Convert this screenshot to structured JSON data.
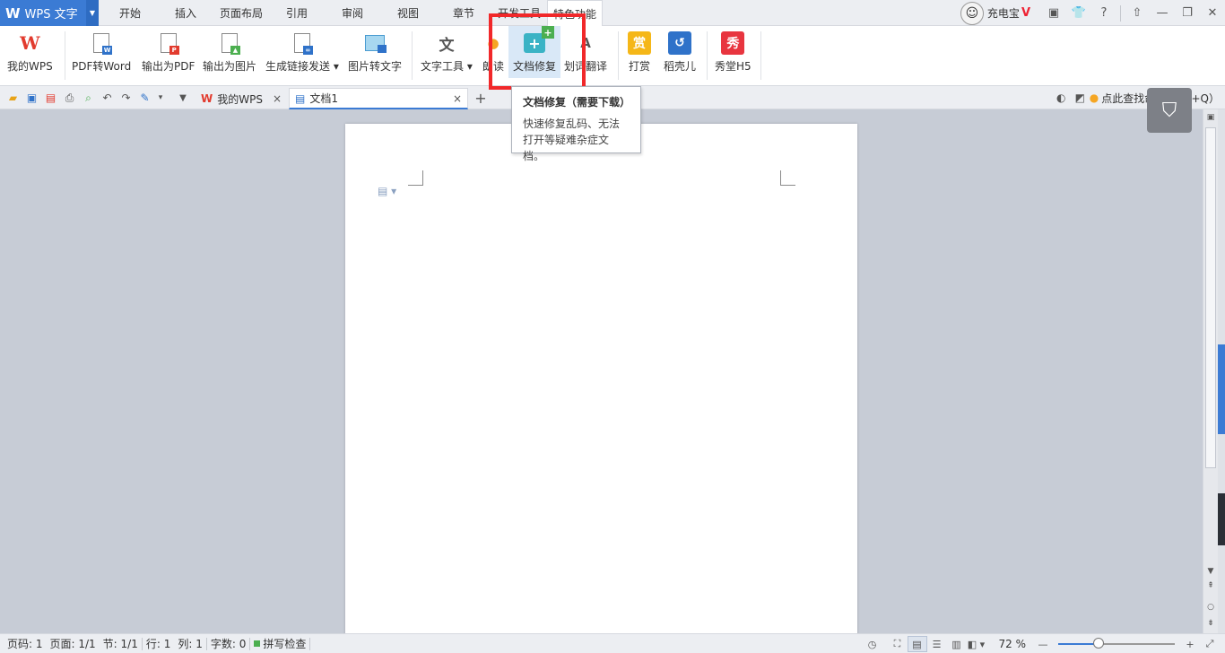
{
  "app": {
    "logo": "W",
    "name": "WPS 文字",
    "dropdown": "▼"
  },
  "menu": {
    "tabs": [
      "开始",
      "插入",
      "页面布局",
      "引用",
      "审阅",
      "视图",
      "章节",
      "开发工具",
      "特色功能"
    ],
    "active_tab": "特色功能"
  },
  "user": {
    "name": "充电宝",
    "vip": "V",
    "avatar_glyph": "☺"
  },
  "window_controls": {
    "skin": "▣",
    "shirt": "👕",
    "help": "?",
    "minimize": "—",
    "restore": "❐",
    "close": "✕",
    "upload": "⇧"
  },
  "ribbon": {
    "my_wps": "我的WPS",
    "pdf_to_word": "PDF转Word",
    "export_pdf": "输出为PDF",
    "export_image": "输出为图片",
    "share_link": "生成链接发送",
    "image_to_text": "图片转文字",
    "text_tools": "文字工具",
    "read_aloud": "朗读",
    "doc_repair": "文档修复",
    "translate": "划词翻译",
    "reward": "打赏",
    "daoke": "稻壳儿",
    "xiutang": "秀堂H5",
    "reward_glyph": "赏",
    "xiu_glyph": "秀",
    "dropdown_arrow": "▾"
  },
  "tabs": {
    "home_tab": "我的WPS",
    "doc_tab": "文档1",
    "close": "×",
    "add": "+"
  },
  "search_hint": "点此查找命令（Alt+Q）",
  "tooltip": {
    "title": "文档修复（需要下载）",
    "body": "快速修复乱码、无法打开等疑难杂症文档。"
  },
  "status": {
    "page_code": "页码: 1",
    "page": "页面: 1/1",
    "section": "节: 1/1",
    "row": "行: 1",
    "col": "列: 1",
    "word_count": "字数: 0",
    "spell_check": "拼写检查",
    "zoom": "72 %",
    "zoom_percent": 72
  },
  "colors": {
    "accent": "#3b7bd4",
    "highlight_box": "#f1282a",
    "wps_red": "#e23b2e"
  }
}
